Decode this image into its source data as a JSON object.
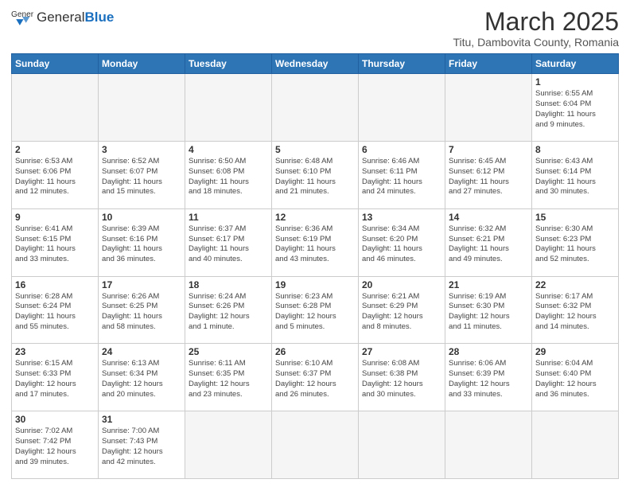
{
  "logo": {
    "text_general": "General",
    "text_blue": "Blue"
  },
  "header": {
    "title": "March 2025",
    "subtitle": "Titu, Dambovita County, Romania"
  },
  "weekdays": [
    "Sunday",
    "Monday",
    "Tuesday",
    "Wednesday",
    "Thursday",
    "Friday",
    "Saturday"
  ],
  "weeks": [
    [
      {
        "day": "",
        "info": ""
      },
      {
        "day": "",
        "info": ""
      },
      {
        "day": "",
        "info": ""
      },
      {
        "day": "",
        "info": ""
      },
      {
        "day": "",
        "info": ""
      },
      {
        "day": "",
        "info": ""
      },
      {
        "day": "1",
        "info": "Sunrise: 6:55 AM\nSunset: 6:04 PM\nDaylight: 11 hours\nand 9 minutes."
      }
    ],
    [
      {
        "day": "2",
        "info": "Sunrise: 6:53 AM\nSunset: 6:06 PM\nDaylight: 11 hours\nand 12 minutes."
      },
      {
        "day": "3",
        "info": "Sunrise: 6:52 AM\nSunset: 6:07 PM\nDaylight: 11 hours\nand 15 minutes."
      },
      {
        "day": "4",
        "info": "Sunrise: 6:50 AM\nSunset: 6:08 PM\nDaylight: 11 hours\nand 18 minutes."
      },
      {
        "day": "5",
        "info": "Sunrise: 6:48 AM\nSunset: 6:10 PM\nDaylight: 11 hours\nand 21 minutes."
      },
      {
        "day": "6",
        "info": "Sunrise: 6:46 AM\nSunset: 6:11 PM\nDaylight: 11 hours\nand 24 minutes."
      },
      {
        "day": "7",
        "info": "Sunrise: 6:45 AM\nSunset: 6:12 PM\nDaylight: 11 hours\nand 27 minutes."
      },
      {
        "day": "8",
        "info": "Sunrise: 6:43 AM\nSunset: 6:14 PM\nDaylight: 11 hours\nand 30 minutes."
      }
    ],
    [
      {
        "day": "9",
        "info": "Sunrise: 6:41 AM\nSunset: 6:15 PM\nDaylight: 11 hours\nand 33 minutes."
      },
      {
        "day": "10",
        "info": "Sunrise: 6:39 AM\nSunset: 6:16 PM\nDaylight: 11 hours\nand 36 minutes."
      },
      {
        "day": "11",
        "info": "Sunrise: 6:37 AM\nSunset: 6:17 PM\nDaylight: 11 hours\nand 40 minutes."
      },
      {
        "day": "12",
        "info": "Sunrise: 6:36 AM\nSunset: 6:19 PM\nDaylight: 11 hours\nand 43 minutes."
      },
      {
        "day": "13",
        "info": "Sunrise: 6:34 AM\nSunset: 6:20 PM\nDaylight: 11 hours\nand 46 minutes."
      },
      {
        "day": "14",
        "info": "Sunrise: 6:32 AM\nSunset: 6:21 PM\nDaylight: 11 hours\nand 49 minutes."
      },
      {
        "day": "15",
        "info": "Sunrise: 6:30 AM\nSunset: 6:23 PM\nDaylight: 11 hours\nand 52 minutes."
      }
    ],
    [
      {
        "day": "16",
        "info": "Sunrise: 6:28 AM\nSunset: 6:24 PM\nDaylight: 11 hours\nand 55 minutes."
      },
      {
        "day": "17",
        "info": "Sunrise: 6:26 AM\nSunset: 6:25 PM\nDaylight: 11 hours\nand 58 minutes."
      },
      {
        "day": "18",
        "info": "Sunrise: 6:24 AM\nSunset: 6:26 PM\nDaylight: 12 hours\nand 1 minute."
      },
      {
        "day": "19",
        "info": "Sunrise: 6:23 AM\nSunset: 6:28 PM\nDaylight: 12 hours\nand 5 minutes."
      },
      {
        "day": "20",
        "info": "Sunrise: 6:21 AM\nSunset: 6:29 PM\nDaylight: 12 hours\nand 8 minutes."
      },
      {
        "day": "21",
        "info": "Sunrise: 6:19 AM\nSunset: 6:30 PM\nDaylight: 12 hours\nand 11 minutes."
      },
      {
        "day": "22",
        "info": "Sunrise: 6:17 AM\nSunset: 6:32 PM\nDaylight: 12 hours\nand 14 minutes."
      }
    ],
    [
      {
        "day": "23",
        "info": "Sunrise: 6:15 AM\nSunset: 6:33 PM\nDaylight: 12 hours\nand 17 minutes."
      },
      {
        "day": "24",
        "info": "Sunrise: 6:13 AM\nSunset: 6:34 PM\nDaylight: 12 hours\nand 20 minutes."
      },
      {
        "day": "25",
        "info": "Sunrise: 6:11 AM\nSunset: 6:35 PM\nDaylight: 12 hours\nand 23 minutes."
      },
      {
        "day": "26",
        "info": "Sunrise: 6:10 AM\nSunset: 6:37 PM\nDaylight: 12 hours\nand 26 minutes."
      },
      {
        "day": "27",
        "info": "Sunrise: 6:08 AM\nSunset: 6:38 PM\nDaylight: 12 hours\nand 30 minutes."
      },
      {
        "day": "28",
        "info": "Sunrise: 6:06 AM\nSunset: 6:39 PM\nDaylight: 12 hours\nand 33 minutes."
      },
      {
        "day": "29",
        "info": "Sunrise: 6:04 AM\nSunset: 6:40 PM\nDaylight: 12 hours\nand 36 minutes."
      }
    ],
    [
      {
        "day": "30",
        "info": "Sunrise: 7:02 AM\nSunset: 7:42 PM\nDaylight: 12 hours\nand 39 minutes."
      },
      {
        "day": "31",
        "info": "Sunrise: 7:00 AM\nSunset: 7:43 PM\nDaylight: 12 hours\nand 42 minutes."
      },
      {
        "day": "",
        "info": ""
      },
      {
        "day": "",
        "info": ""
      },
      {
        "day": "",
        "info": ""
      },
      {
        "day": "",
        "info": ""
      },
      {
        "day": "",
        "info": ""
      }
    ]
  ]
}
